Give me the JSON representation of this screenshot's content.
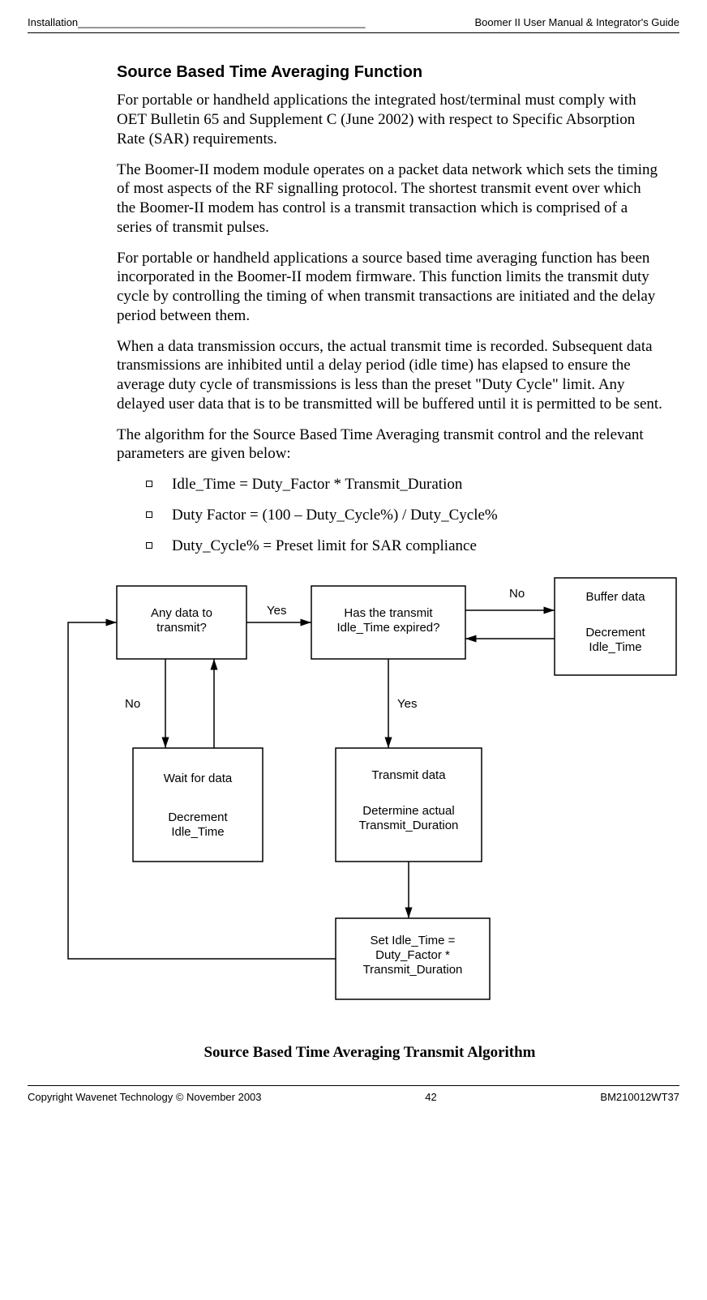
{
  "header": {
    "left": "Installation",
    "right": "Boomer II User Manual & Integrator's Guide"
  },
  "section_title": "Source Based Time Averaging Function",
  "paragraphs": {
    "p1": "For portable or handheld applications the integrated host/terminal must comply with OET Bulletin 65 and Supplement C (June 2002) with respect to Specific Absorption Rate (SAR) requirements.",
    "p2": "The Boomer-II modem module operates on a packet data network which sets the timing of most aspects of the RF signalling protocol. The shortest transmit event over which the Boomer-II modem has control is a transmit transaction which is comprised of a series of transmit pulses.",
    "p3": "For portable or handheld applications a source based time averaging function has been incorporated in the Boomer-II modem firmware. This function limits the transmit duty cycle by controlling the timing of when transmit transactions are initiated and the delay period between them.",
    "p4": "When a data transmission occurs, the actual transmit time is recorded. Subsequent data transmissions are inhibited until a delay period (idle time) has elapsed to ensure the average duty cycle of transmissions is less than the preset \"Duty Cycle\" limit. Any delayed user data that is to be transmitted will be buffered until it is permitted to be sent.",
    "p5": "The algorithm for the Source Based Time Averaging transmit control and the relevant parameters are given below:"
  },
  "bullets": {
    "b1": "Idle_Time = Duty_Factor * Transmit_Duration",
    "b2": "Duty Factor = (100 – Duty_Cycle%) / Duty_Cycle%",
    "b3": "Duty_Cycle% = Preset limit for SAR compliance"
  },
  "flow": {
    "box1_l1": "Any data to",
    "box1_l2": "transmit?",
    "box2_l1": "Has the transmit",
    "box2_l2": "Idle_Time expired?",
    "box3_l1": "Buffer data",
    "box3_l2": "Decrement",
    "box3_l3": "Idle_Time",
    "box4_l1": "Wait for data",
    "box4_l2": "Decrement",
    "box4_l3": "Idle_Time",
    "box5_l1": "Transmit data",
    "box5_l2": "Determine actual",
    "box5_l3": "Transmit_Duration",
    "box6_l1": "Set Idle_Time =",
    "box6_l2": "Duty_Factor *",
    "box6_l3": "Transmit_Duration",
    "lbl_yes": "Yes",
    "lbl_no": "No"
  },
  "caption": "Source Based Time Averaging Transmit Algorithm",
  "footer": {
    "left": "Copyright Wavenet Technology © November 2003",
    "center": "42",
    "right": "BM210012WT37"
  }
}
